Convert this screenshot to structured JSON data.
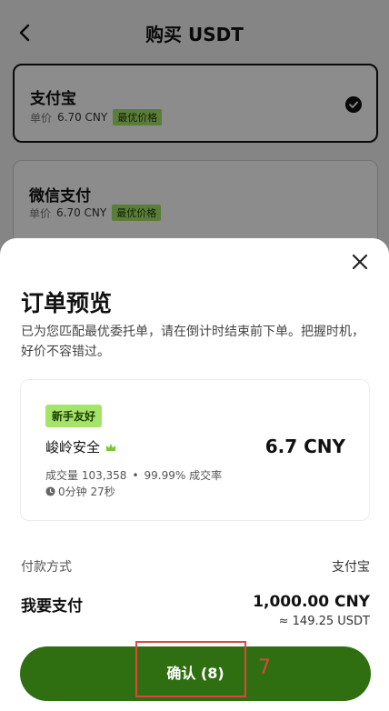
{
  "header": {
    "title": "购买 USDT"
  },
  "payment_options": [
    {
      "name": "支付宝",
      "price_label": "单价",
      "price": "6.70 CNY",
      "badge": "最优价格",
      "selected": true
    },
    {
      "name": "微信支付",
      "price_label": "单价",
      "price": "6.70 CNY",
      "badge": "最优价格",
      "selected": false
    }
  ],
  "sheet": {
    "title": "订单预览",
    "description": "已为您匹配最优委托单，请在倒计时结束前下单。把握时机，好价不容错过。",
    "offer": {
      "badge": "新手友好",
      "merchant": "峻岭安全",
      "price": "6.7 CNY",
      "volume": "成交量 103,358",
      "separator": "•",
      "completion": "99.99% 成交率",
      "timer": "0分钟 27秒"
    },
    "payment_method_label": "付款方式",
    "payment_method_value": "支付宝",
    "pay_label": "我要支付",
    "pay_amount": "1,000.00 CNY",
    "pay_approx": "≈ 149.25 USDT",
    "confirm_label": "确认 (8)",
    "annotation_number": "7"
  },
  "colors": {
    "accent_green": "#2f6f12",
    "badge_green": "#a6e36a",
    "annotation_red": "#e0463a"
  }
}
